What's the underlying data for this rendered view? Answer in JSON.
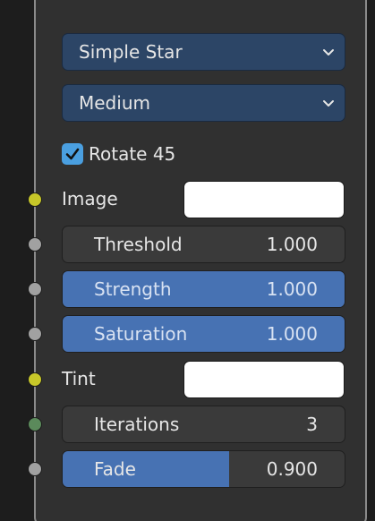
{
  "node": {
    "filter_type": "Simple Star",
    "quality": "Medium",
    "rotate_45": {
      "label": "Rotate 45",
      "checked": true
    },
    "image_label": "Image",
    "tint_label": "Tint",
    "fields": [
      {
        "label": "Threshold",
        "value": "1.000",
        "fill": 0
      },
      {
        "label": "Strength",
        "value": "1.000",
        "fill": 1
      },
      {
        "label": "Saturation",
        "value": "1.000",
        "fill": 1
      },
      {
        "label": "Iterations",
        "value": "3",
        "fill": 0
      },
      {
        "label": "Fade",
        "value": "0.900",
        "fill": 0.59
      }
    ]
  },
  "colors": {
    "dropdown_bg": "#2c4566",
    "field_bg": "#3a3a3a",
    "field_fill": "#4772b3",
    "socket_color": "#c7c729",
    "socket_value": "#a1a1a1",
    "socket_int": "#5b8a5b",
    "checkbox": "#4a9fe0",
    "swatch_image": "#ffffff",
    "swatch_tint": "#ffffff"
  },
  "icons": {
    "dropdown_chevron": "chevron-down-icon",
    "checkbox_mark": "checkmark-icon"
  }
}
